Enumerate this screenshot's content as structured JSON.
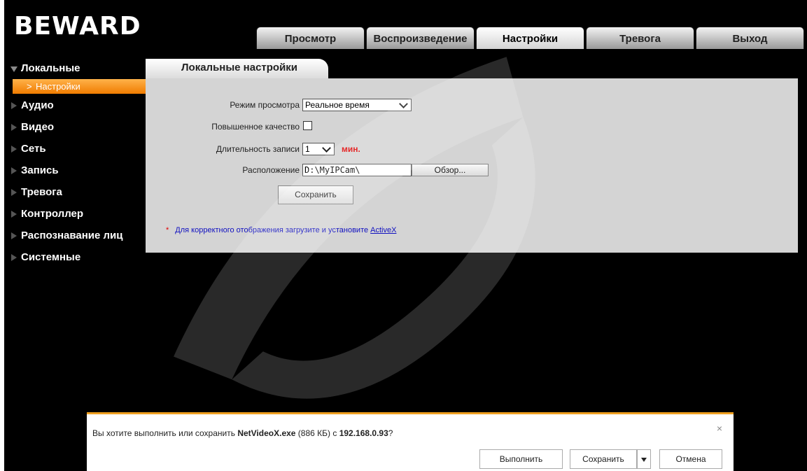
{
  "header": {
    "logo": "BEWARD",
    "tabs": [
      {
        "label": "Просмотр",
        "active": false
      },
      {
        "label": "Воспроизведение",
        "active": false
      },
      {
        "label": "Настройки",
        "active": true
      },
      {
        "label": "Тревога",
        "active": false
      },
      {
        "label": "Выход",
        "active": false
      }
    ]
  },
  "sidebar": {
    "items": [
      {
        "label": "Локальные",
        "open": true
      },
      {
        "label": "Аудио"
      },
      {
        "label": "Видео"
      },
      {
        "label": "Сеть"
      },
      {
        "label": "Запись"
      },
      {
        "label": "Тревога"
      },
      {
        "label": "Контроллер"
      },
      {
        "label": "Распознавание лиц"
      },
      {
        "label": "Системные"
      }
    ],
    "active_sub": "Настройки"
  },
  "content": {
    "tab_title": "Локальные настройки",
    "view_mode": {
      "label": "Режим просмотра",
      "value": "Реальное время"
    },
    "quality": {
      "label": "Повышенное качество",
      "checked": false
    },
    "duration": {
      "label": "Длительность записи",
      "value": "1",
      "unit": "мин."
    },
    "location": {
      "label": "Расположение",
      "value": "D:\\MyIPCam\\",
      "browse_label": "Обзор..."
    },
    "save_label": "Сохранить",
    "note": {
      "star": "*",
      "text": "Для корректного отображения загрузите и установите ",
      "link": "ActiveX"
    }
  },
  "download_bar": {
    "prefix": "Вы хотите выполнить или сохранить ",
    "filename": "NetVideoX.exe",
    "size": " (886 КБ) с ",
    "host": "192.168.0.93",
    "suffix": "?",
    "run_label": "Выполнить",
    "save_label": "Сохранить",
    "cancel_label": "Отмена",
    "close_glyph": "×"
  },
  "colors": {
    "accent": "#f07c00",
    "panel": "#d4d4d4",
    "unit": "#e00000",
    "link": "#1010c0"
  }
}
